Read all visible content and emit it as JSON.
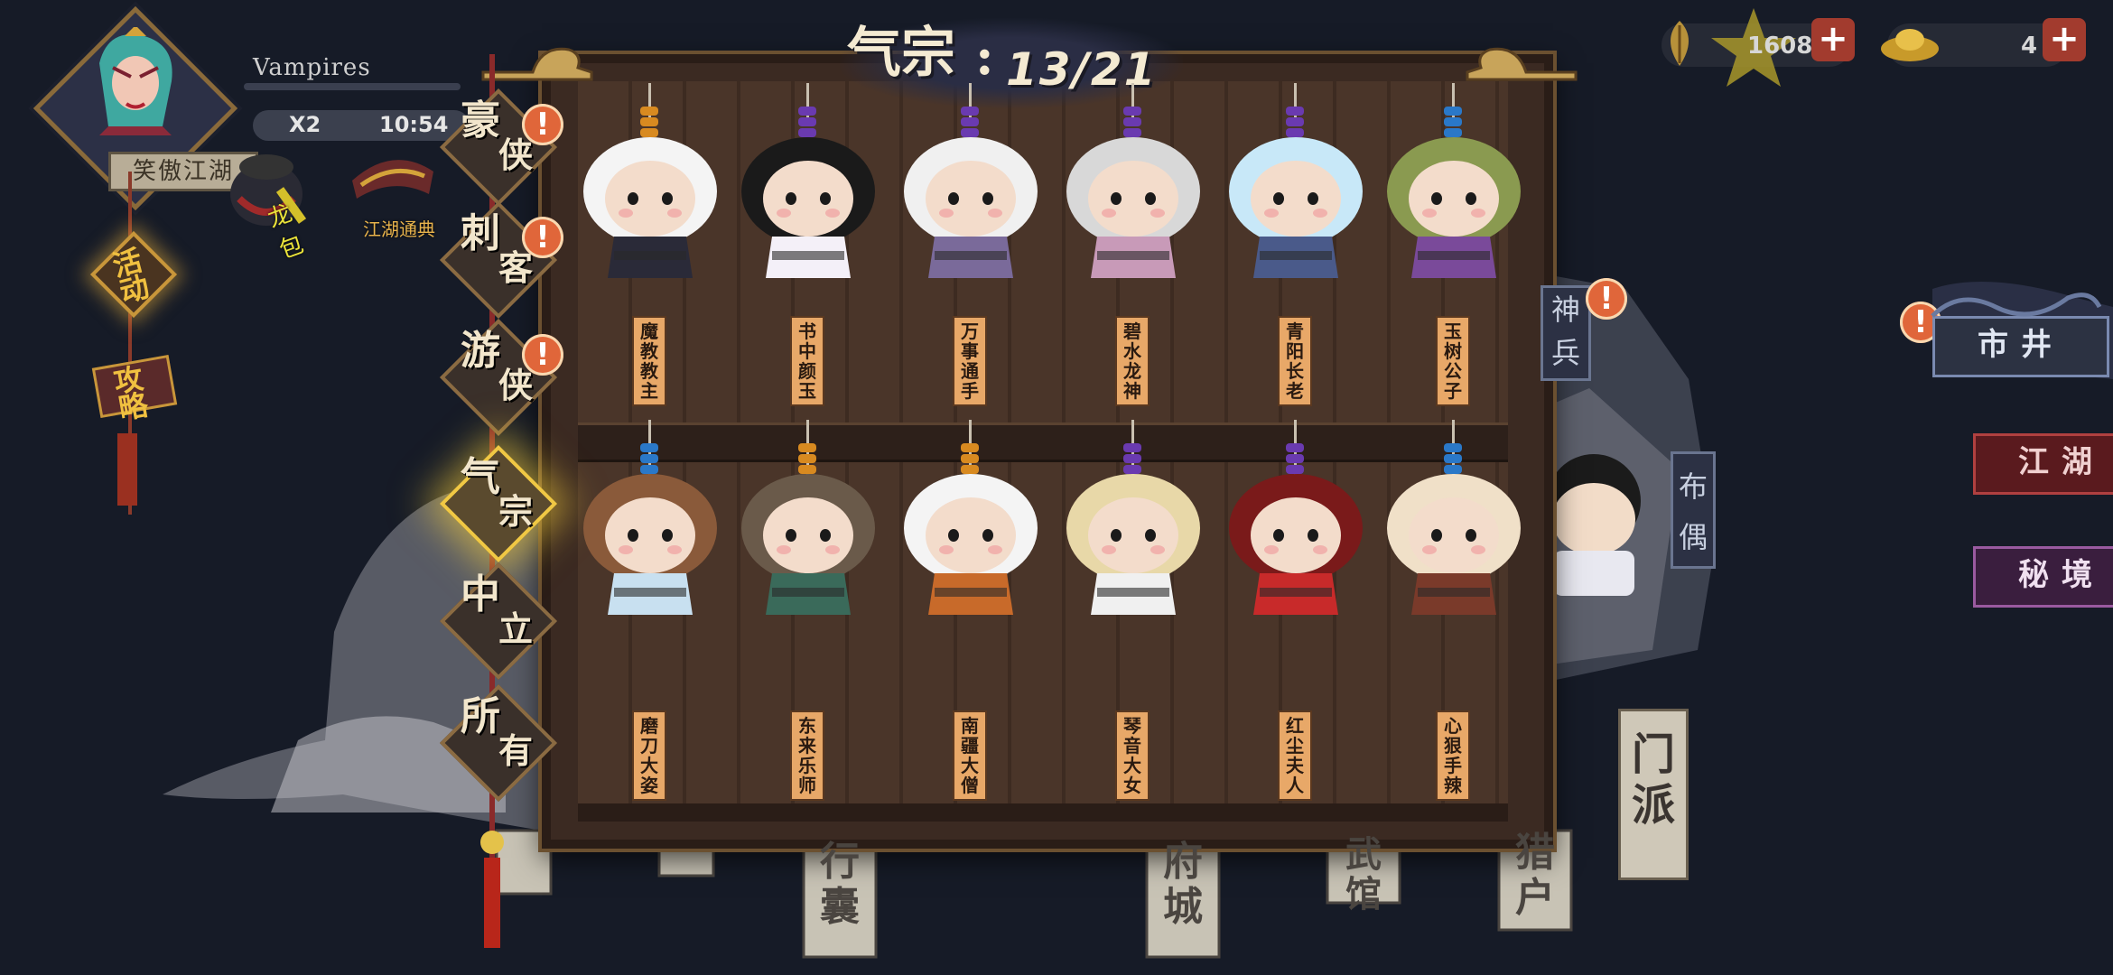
{
  "player": {
    "name": "Vampires",
    "multiplier": "X2",
    "timer": "10:54",
    "sect": "笑傲江湖"
  },
  "features": {
    "left_icon_label": "龙包",
    "encyclopedia_label": "江湖通典",
    "event_label": "活动",
    "guide_label": "攻略"
  },
  "currency": {
    "gold_leaf": "1608",
    "ingot": "4"
  },
  "collection": {
    "title": "气宗",
    "count": "13/21"
  },
  "categories": [
    {
      "label_top": "豪",
      "label_bottom": "侠",
      "badge": "!"
    },
    {
      "label_top": "刺",
      "label_bottom": "客",
      "badge": "!"
    },
    {
      "label_top": "游",
      "label_bottom": "侠",
      "badge": "!"
    },
    {
      "label_top": "气",
      "label_bottom": "宗",
      "badge": ""
    },
    {
      "label_top": "中",
      "label_bottom": "立",
      "badge": ""
    },
    {
      "label_top": "所",
      "label_bottom": "有",
      "badge": ""
    }
  ],
  "dolls_top": [
    "魔教教主",
    "书中颜玉",
    "万事通手",
    "碧水龙神",
    "青阳长老",
    "玉树公子"
  ],
  "dolls_bottom": [
    "磨刀大姿",
    "东来乐师",
    "南疆大僧",
    "琴音大女",
    "红尘夫人",
    "心狠手辣"
  ],
  "right_menu": {
    "market": "市井",
    "jianghu": "江湖",
    "secret": "秘境"
  },
  "map_labels": {
    "shenbing": "神兵",
    "buou": "布偶",
    "menpai": "门派",
    "city": "府城",
    "bottom1": "行囊",
    "bottom2": "武馆",
    "bottom3": "猎户"
  },
  "colors": {
    "accent_gold": "#f0c844",
    "badge_orange": "#e0663a",
    "plus_red": "#a23b2e"
  }
}
